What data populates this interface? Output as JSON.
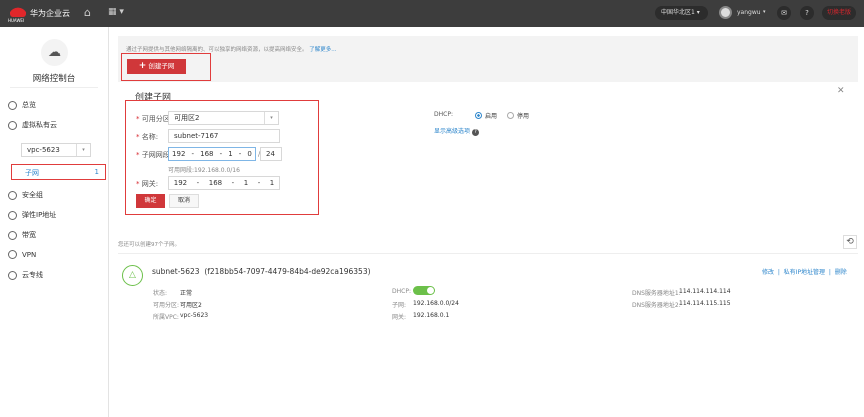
{
  "topbar": {
    "brand": "华为企业云",
    "logo_text": "HUAWEI",
    "region": "中国华北区1",
    "user": "yangwu",
    "switch": "切换老版"
  },
  "sidebar": {
    "title": "网络控制台",
    "items": [
      {
        "label": "总览"
      },
      {
        "label": "虚拟私有云"
      },
      {
        "label": "安全组"
      },
      {
        "label": "弹性IP地址"
      },
      {
        "label": "带宽"
      },
      {
        "label": "VPN"
      },
      {
        "label": "云专线"
      }
    ],
    "vpc_select": "vpc-5623",
    "sub_item": {
      "label": "子网",
      "count": "1"
    }
  },
  "main": {
    "info": "通过子网提供与其他网络隔离的、可以独享的网络资源，以提高网络安全。",
    "learn_more": "了解更多...",
    "create_button": "创建子网",
    "form": {
      "title": "创建子网",
      "az_label": "可用分区:",
      "az_value": "可用区2",
      "name_label": "名称:",
      "name_value": "subnet-7167",
      "cidr_label": "子网网段:",
      "cidr": [
        "192",
        "168",
        "1",
        "0"
      ],
      "mask": "24",
      "cidr_hint": "可用网段:192.168.0.0/16",
      "gw_label": "网关:",
      "gw": [
        "192",
        "168",
        "1",
        "1"
      ],
      "ok": "确定",
      "cancel": "取消",
      "dhcp_label": "DHCP:",
      "dhcp_on": "启用",
      "dhcp_off": "停用",
      "advanced": "显示高级选项"
    },
    "quota": "您还可以创建97个子网。",
    "subnet": {
      "name": "subnet-5623",
      "id": "(f218bb54-7097-4479-84b4-de92ca196353)",
      "actions": [
        "修改",
        "私有IP地址管理",
        "删除"
      ],
      "status_label": "状态:",
      "status": "正常",
      "az_label": "可用分区:",
      "az": "可用区2",
      "vpc_label": "所属VPC:",
      "vpc": "vpc-5623",
      "dhcp_label": "DHCP:",
      "dhcp_enabled": true,
      "subnet_label": "子网:",
      "subnet": "192.168.0.0/24",
      "gw_label": "网关:",
      "gw": "192.168.0.1",
      "dns1_label": "DNS服务器地址1:",
      "dns1": "114.114.114.114",
      "dns2_label": "DNS服务器地址2:",
      "dns2": "114.114.115.115"
    }
  }
}
